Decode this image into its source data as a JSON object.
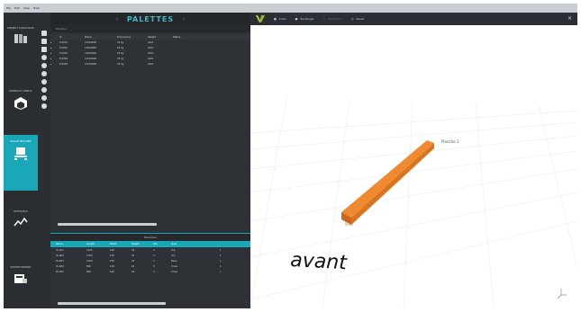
{
  "menubar": {
    "items": [
      "File",
      "Edit",
      "View",
      "Help"
    ]
  },
  "nav": {
    "items": [
      {
        "label": "PROJECT CATALOGUE",
        "icon": "catalogue-icon"
      },
      {
        "label": "PRODUCT CONFIG",
        "icon": "cube-icon"
      },
      {
        "label": "PALLET BUILDER",
        "icon": "pallet-icon",
        "active": true
      },
      {
        "label": "STATISTICS",
        "icon": "chart-line-icon"
      },
      {
        "label": "EXPORT REPORT",
        "icon": "export-icon"
      }
    ]
  },
  "panel": {
    "title": "PALETTES",
    "subtitle": "Palettes",
    "columns": [
      "",
      "Id",
      "Name",
      "Dimensions",
      "Weight",
      "Status",
      "",
      ""
    ],
    "rows": [
      [
        "▸",
        "P-0001",
        "1200x800",
        "25 kg",
        "Valid",
        "",
        ""
      ],
      [
        "▸",
        "P-0002",
        "1200x800",
        "25 kg",
        "Valid",
        "",
        ""
      ],
      [
        "▸",
        "P-0003",
        "1200x800",
        "25 kg",
        "Valid",
        "",
        ""
      ],
      [
        "▸",
        "P-0004",
        "1200x800",
        "25 kg",
        "Valid",
        "",
        ""
      ],
      [
        "▸",
        "P-0005",
        "1200x800",
        "25 kg",
        "Valid",
        "",
        ""
      ]
    ]
  },
  "bottom": {
    "title": "Planches",
    "columns": [
      "Name",
      "Length",
      "Width",
      "Height",
      "Qty",
      "Type",
      "",
      ""
    ],
    "rows": [
      [
        "PL-001",
        "1200",
        "100",
        "22",
        "4",
        "Top",
        "",
        "1"
      ],
      [
        "PL-002",
        "1200",
        "100",
        "22",
        "4",
        "Top",
        "",
        "1"
      ],
      [
        "PL-003",
        "1200",
        "100",
        "22",
        "2",
        "Base",
        "",
        "1"
      ],
      [
        "PL-004",
        "800",
        "100",
        "22",
        "3",
        "Cross",
        "",
        "1"
      ],
      [
        "PL-005",
        "800",
        "100",
        "22",
        "3",
        "Cross",
        "",
        "1"
      ]
    ]
  },
  "viewer": {
    "toolbar": [
      "Cube",
      "Rectangle",
      "Wireframe",
      "Reset"
    ],
    "label": "avant",
    "beam_label": "Planche 1",
    "accent": "#1aa7b8",
    "beam_color": "#e07820"
  }
}
